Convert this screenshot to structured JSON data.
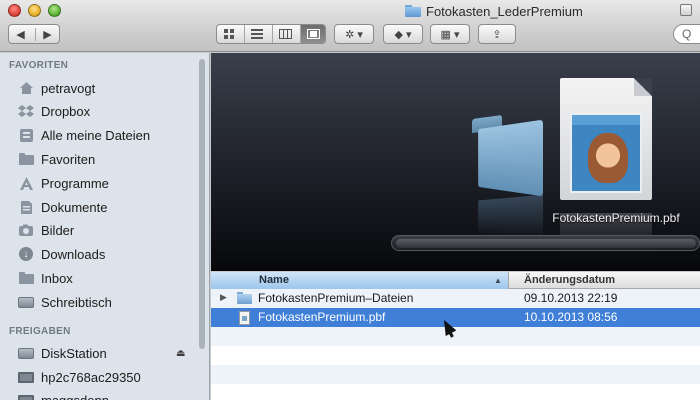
{
  "window": {
    "title": "Fotokasten_LederPremium"
  },
  "toolbar": {
    "back_icon": "◀",
    "forward_icon": "▶",
    "view_icons": [
      "icon-view",
      "list-view",
      "column-view",
      "coverflow-view"
    ],
    "action_label": "✲ ▾",
    "dropbox_label": "◆ ▾",
    "arrange_label": "▦ ▾",
    "share_label": "⇪",
    "search_placeholder": "Q"
  },
  "sidebar": {
    "favorites_heading": "FAVORITEN",
    "favorites": [
      {
        "label": "petravogt",
        "icon": "home-icon"
      },
      {
        "label": "Dropbox",
        "icon": "dropbox-icon"
      },
      {
        "label": "Alle meine Dateien",
        "icon": "all-files-icon"
      },
      {
        "label": "Favoriten",
        "icon": "folder-icon"
      },
      {
        "label": "Programme",
        "icon": "applications-icon"
      },
      {
        "label": "Dokumente",
        "icon": "documents-icon"
      },
      {
        "label": "Bilder",
        "icon": "pictures-icon"
      },
      {
        "label": "Downloads",
        "icon": "downloads-icon"
      },
      {
        "label": "Inbox",
        "icon": "folder-icon"
      },
      {
        "label": "Schreibtisch",
        "icon": "desktop-icon"
      }
    ],
    "shared_heading": "FREIGABEN",
    "shared": [
      {
        "label": "DiskStation",
        "icon": "disk-icon",
        "eject": "⏏"
      },
      {
        "label": "hp2c768ac29350",
        "icon": "monitor-icon"
      },
      {
        "label": "maggsdenn",
        "icon": "monitor-icon"
      }
    ]
  },
  "preview": {
    "caption": "FotokastenPremium.pbf"
  },
  "list": {
    "columns": {
      "name": "Name",
      "date": "Änderungsdatum"
    },
    "sort_indicator": "▲",
    "rows": [
      {
        "name": "FotokastenPremium–Dateien",
        "date": "09.10.2013 22:19",
        "type": "folder",
        "disclosure": "▶"
      },
      {
        "name": "FotokastenPremium.pbf",
        "date": "10.10.2013 08:56",
        "type": "document",
        "selected": true
      }
    ]
  },
  "colors": {
    "selection": "#3f7fd8",
    "sidebar_bg": "#dde3ea",
    "preview_bg": "#1d2028"
  }
}
